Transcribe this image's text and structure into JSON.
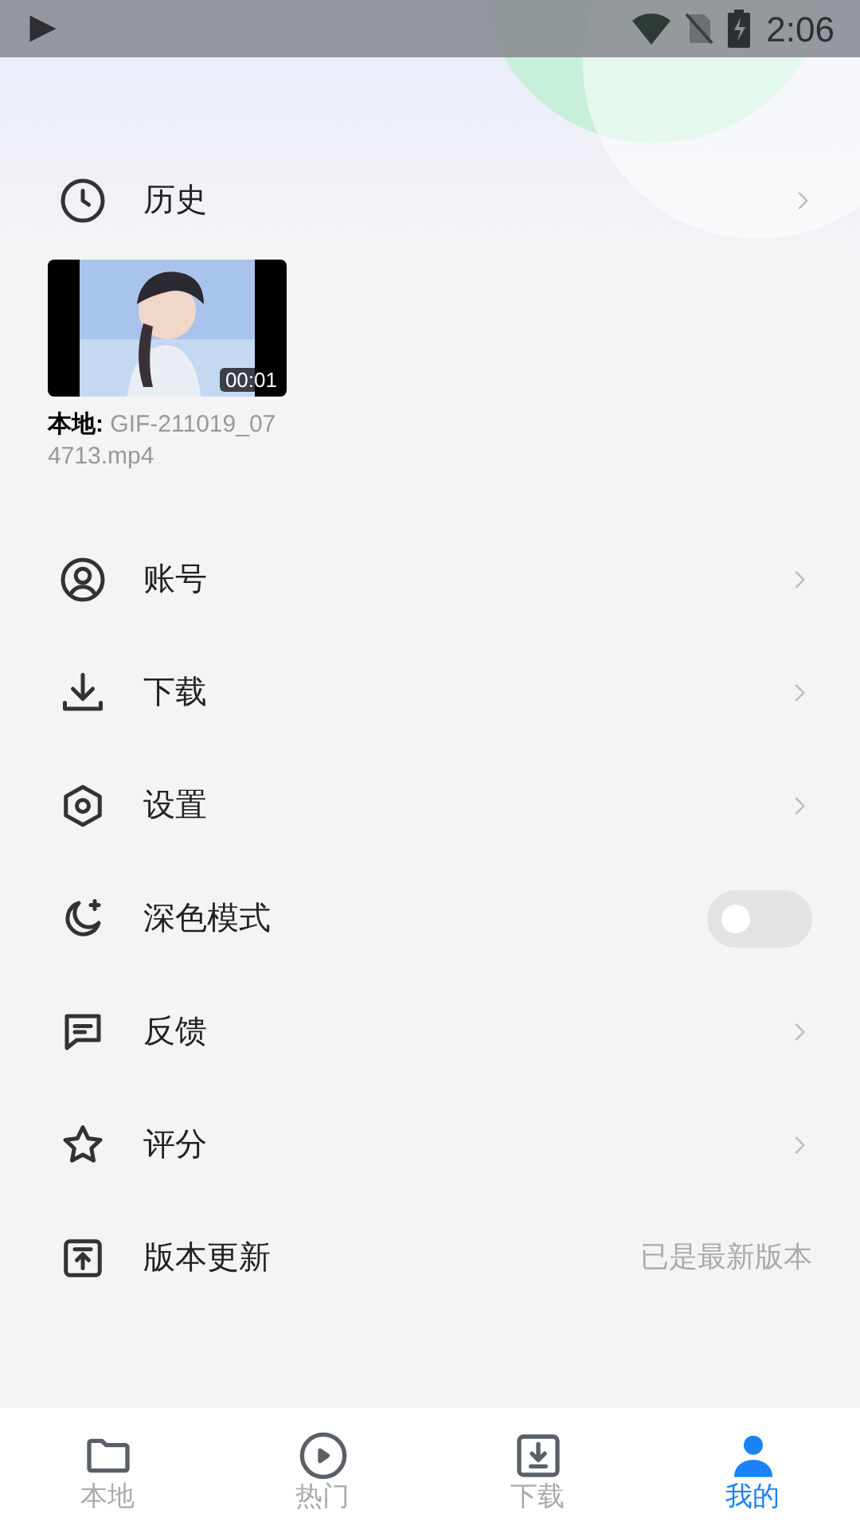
{
  "status_bar": {
    "time": "2:06"
  },
  "history": {
    "title": "历史",
    "items": [
      {
        "duration": "00:01",
        "source_label": "本地:",
        "filename": "GIF-211019_074713.mp4"
      }
    ]
  },
  "menu": [
    {
      "kind": "link",
      "label": "账号"
    },
    {
      "kind": "link",
      "label": "下载"
    },
    {
      "kind": "link",
      "label": "设置"
    },
    {
      "kind": "toggle",
      "label": "深色模式",
      "on": false
    },
    {
      "kind": "link",
      "label": "反馈"
    },
    {
      "kind": "link",
      "label": "评分"
    },
    {
      "kind": "info",
      "label": "版本更新",
      "value": "已是最新版本"
    }
  ],
  "bottom_nav": [
    {
      "label": "本地",
      "selected": false
    },
    {
      "label": "热门",
      "selected": false
    },
    {
      "label": "下载",
      "selected": false
    },
    {
      "label": "我的",
      "selected": true
    }
  ]
}
